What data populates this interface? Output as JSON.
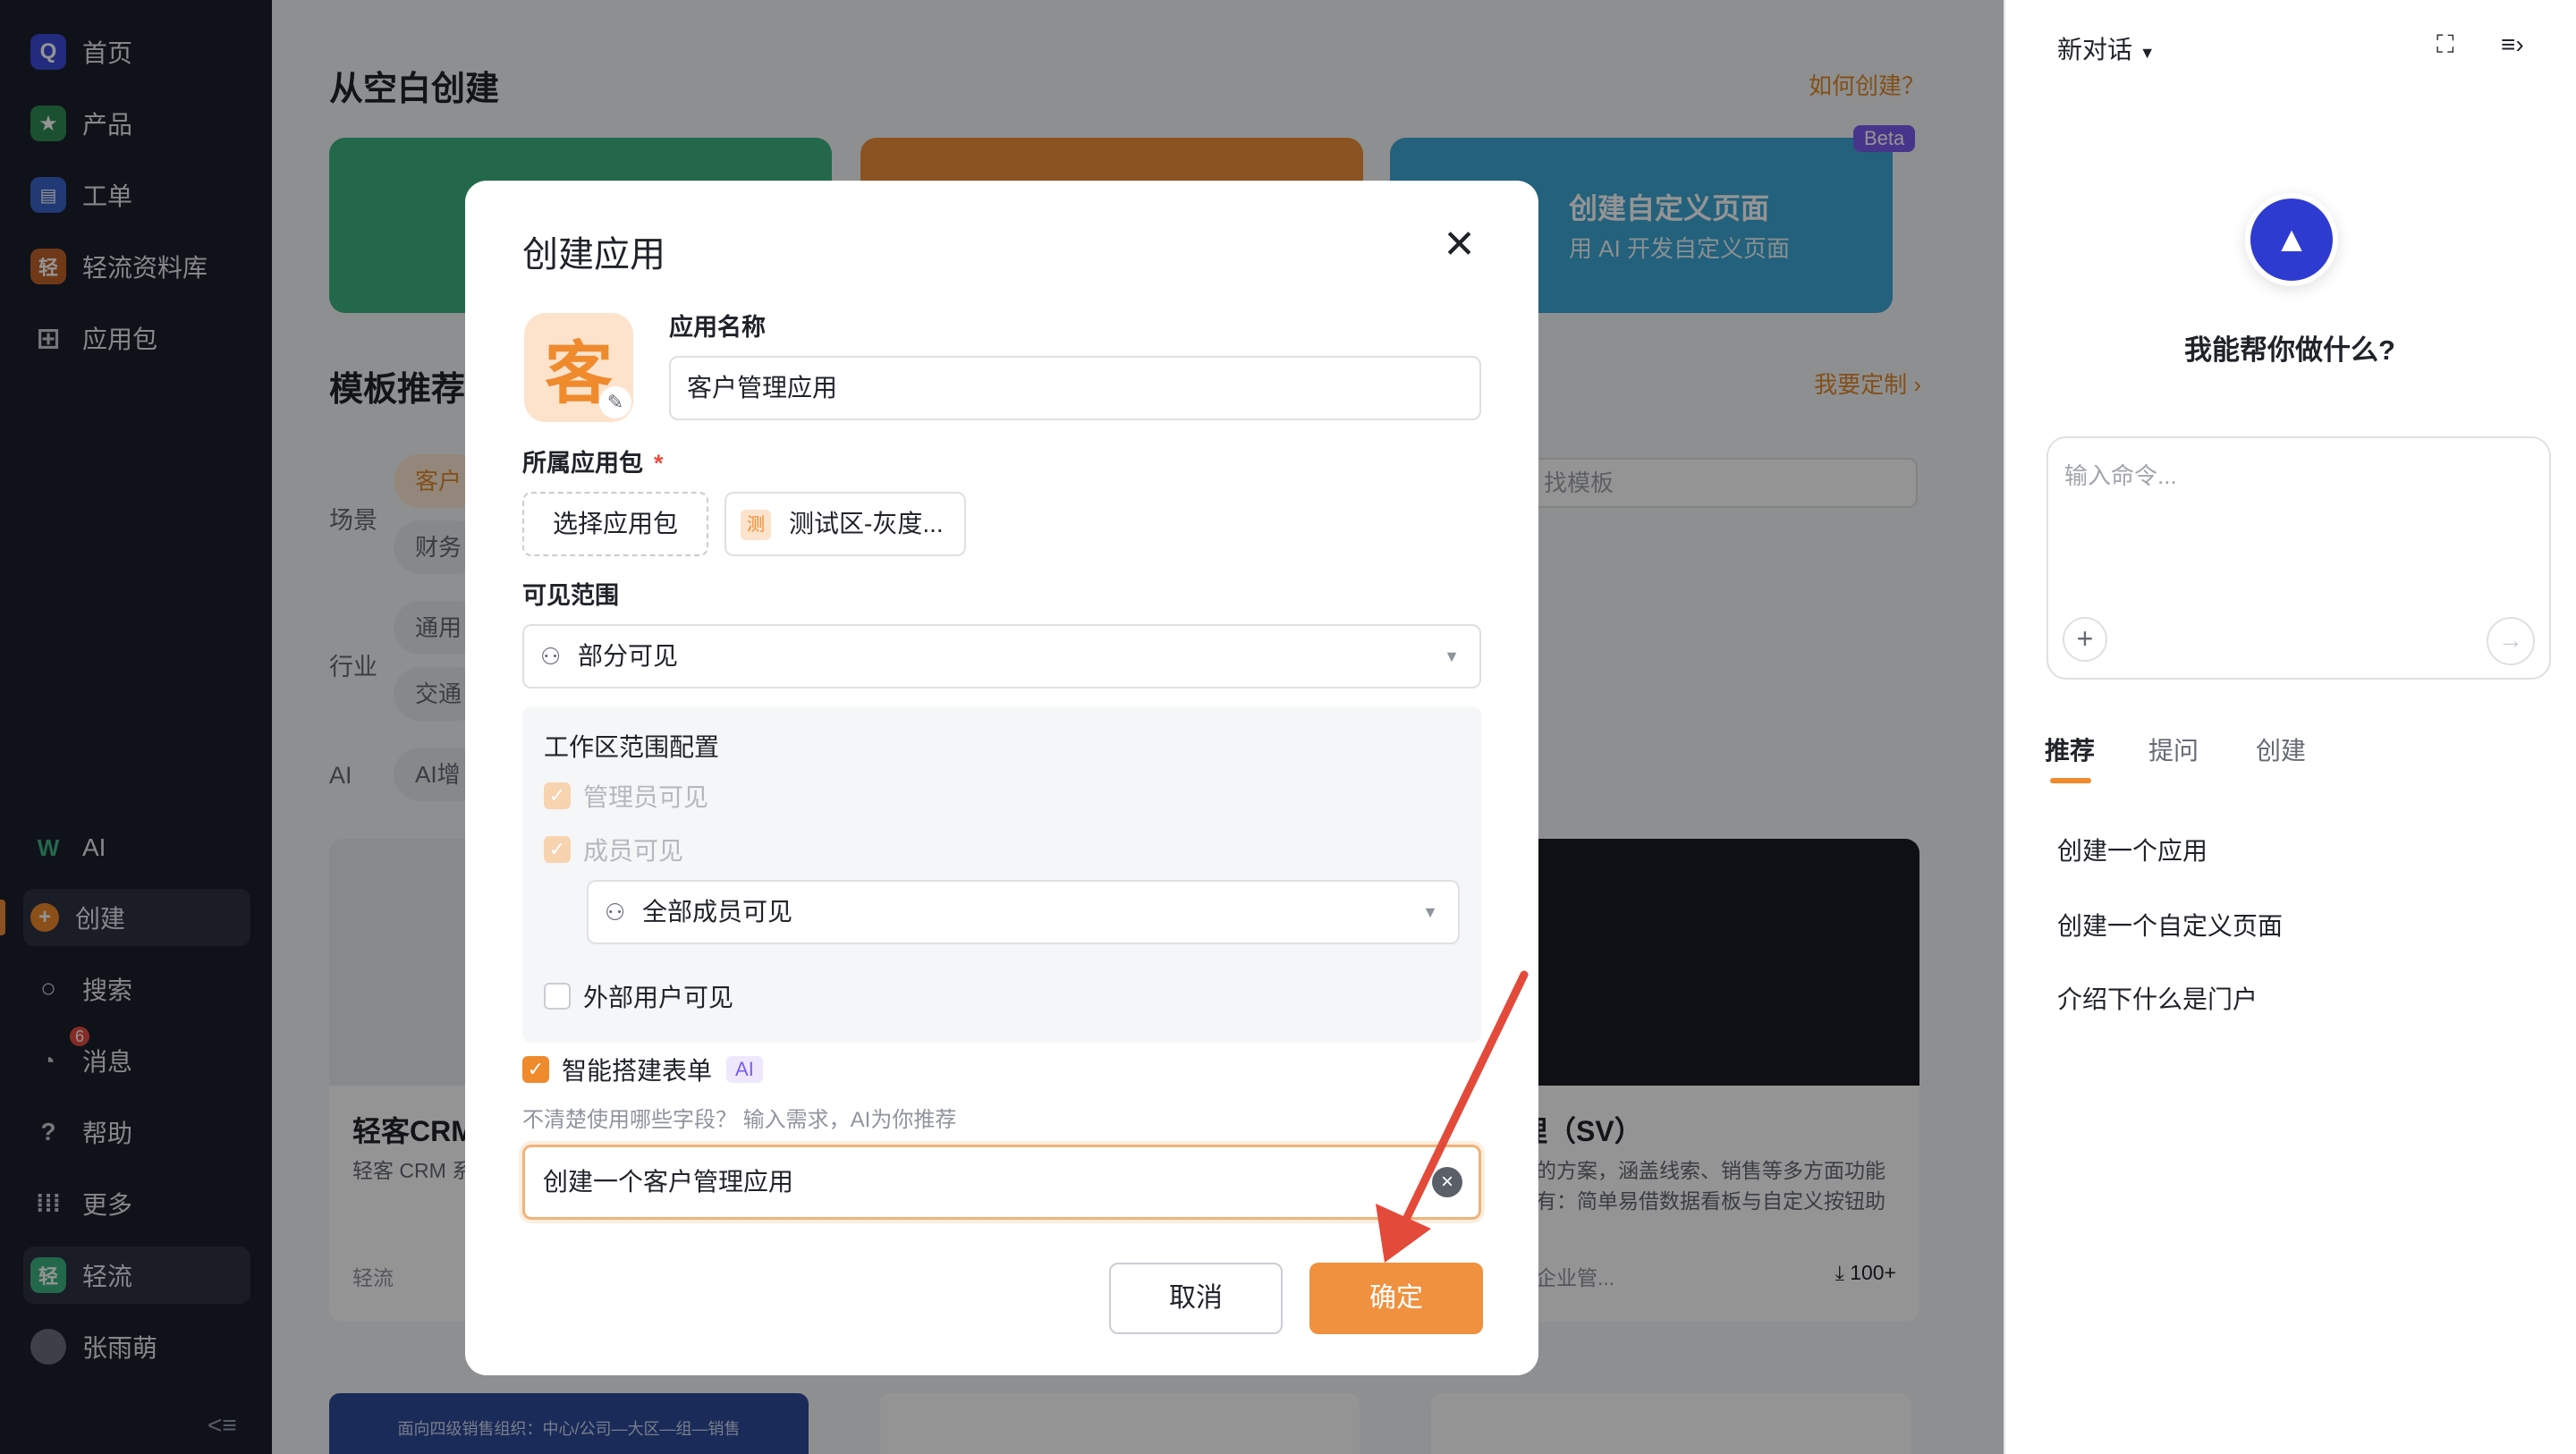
{
  "sidebar": {
    "items": [
      {
        "label": "首页",
        "icon": "home-icon"
      },
      {
        "label": "产品",
        "icon": "star-icon"
      },
      {
        "label": "工单",
        "icon": "document-icon"
      },
      {
        "label": "轻流资料库",
        "icon": "library-icon"
      },
      {
        "label": "应用包",
        "icon": "grid-icon"
      },
      {
        "label": "AI",
        "icon": "ai-icon"
      },
      {
        "label": "创建",
        "icon": "plus-icon"
      },
      {
        "label": "搜索",
        "icon": "search-icon"
      },
      {
        "label": "消息",
        "icon": "bell-icon"
      },
      {
        "label": "帮助",
        "icon": "help-icon"
      },
      {
        "label": "更多",
        "icon": "apps-icon"
      },
      {
        "label": "轻流",
        "icon": "workspace-icon"
      },
      {
        "label": "张雨萌",
        "icon": "avatar"
      }
    ],
    "message_badge": "6",
    "brand_icon_glyphs": {
      "home": "Q",
      "library": "轻",
      "workspace": "轻"
    }
  },
  "main": {
    "title": "从空白创建",
    "how_link": "如何创建？",
    "blue_card": {
      "title": "创建自定义页面",
      "subtitle": "用 AI 开发自定义页面",
      "tag": "Beta"
    },
    "section_title": "模板推荐",
    "customize_link": "我要定制",
    "filters": {
      "scene_label": "场景",
      "industry_label": "行业",
      "ai_label": "AI",
      "chips": [
        "客户",
        "财务",
        "通用",
        "交通",
        "AI增"
      ]
    },
    "search_placeholder": "找模板",
    "templates": [
      {
        "title": "轻客CRM",
        "desc": "轻客 CRM 系方案，能自订单流程线",
        "meta": "轻流",
        "count": ""
      },
      {
        "title": "线索管理（SV）",
        "desc": "型销售组织的方案，涵盖线索、销售等多方面功能布局。优点有：简单易借数据看板与自定义按钮助力销售...",
        "meta": "海久伴轻容企业管...",
        "count": "100+"
      }
    ],
    "bottom_card_text": "面向四级销售组织：中心/公司—大区—组—销售"
  },
  "modal": {
    "title": "创建应用",
    "app_icon_char": "客",
    "app_name_label": "应用名称",
    "app_name_value": "客户管理应用",
    "package_label": "所属应用包",
    "package_required": "*",
    "select_package": "选择应用包",
    "package_chip_icon": "测",
    "package_chip": "测试区-灰度...",
    "visibility_label": "可见范围",
    "visibility_value": "部分可见",
    "workspace_title": "工作区范围配置",
    "admin_visible": "管理员可见",
    "member_visible": "成员可见",
    "member_scope_value": "全部成员可见",
    "external_visible": "外部用户可见",
    "smart_form_label": "智能搭建表单",
    "ai_tag": "AI",
    "hint": "不清楚使用哪些字段？ 输入需求，AI为你推荐",
    "ai_input_value": "创建一个客户管理应用",
    "cancel": "取消",
    "confirm": "确定"
  },
  "right_panel": {
    "title": "新对话",
    "question": "我能帮你做什么?",
    "command_placeholder": "输入命令...",
    "tabs": [
      "推荐",
      "提问",
      "创建"
    ],
    "suggestions": [
      "创建一个应用",
      "创建一个自定义页面",
      "介绍下什么是门户"
    ]
  },
  "colors": {
    "accent": "#ef8a2d",
    "sidebar_bg": "#1c1f2e",
    "ai_purple": "#7b5cf0",
    "arrow": "#e34a3a"
  }
}
